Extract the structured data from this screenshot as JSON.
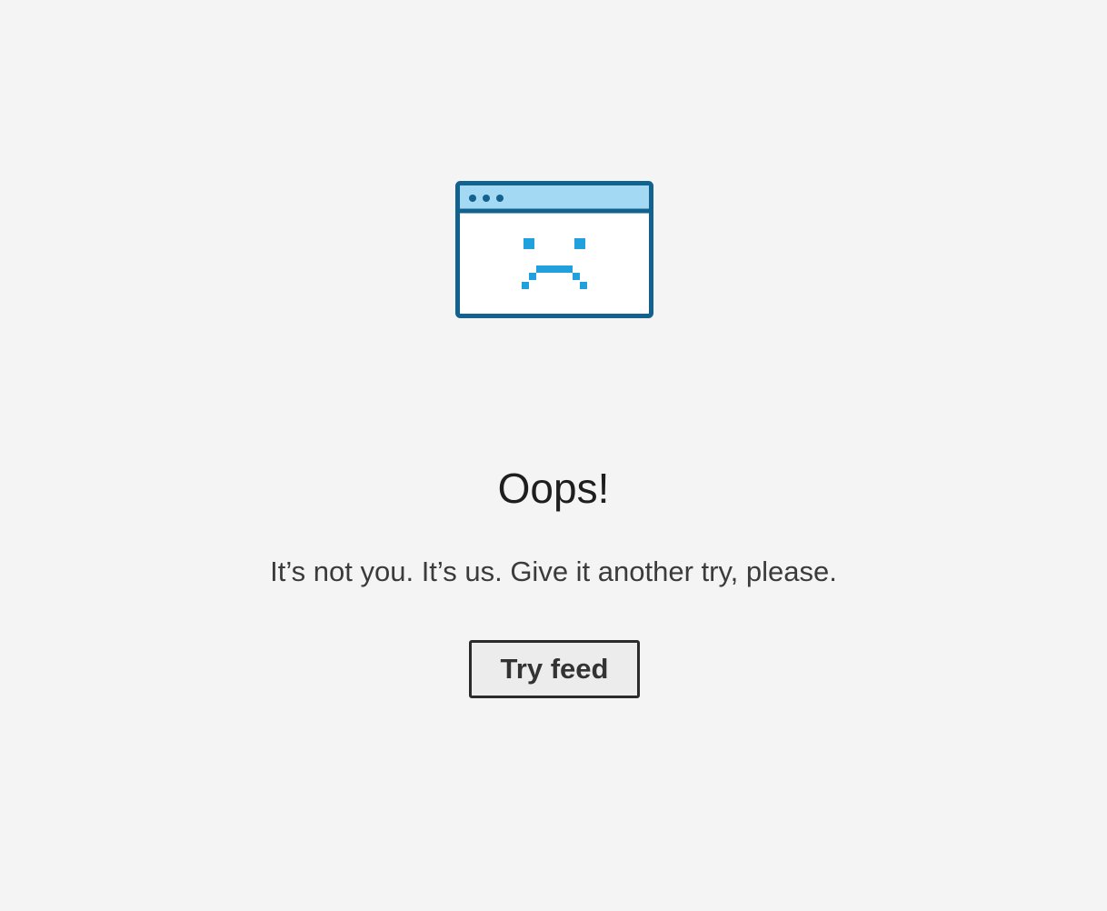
{
  "error": {
    "title": "Oops!",
    "message": "It’s not you. It’s us. Give it another try, please.",
    "button_label": "Try feed"
  },
  "illustration": {
    "icon": "sad-browser-window-icon",
    "colors": {
      "frame": "#12628f",
      "titlebar": "#a3d9f3",
      "window_body": "#ffffff",
      "face": "#20a0dc"
    }
  },
  "colors": {
    "background": "#f4f4f4",
    "title_text": "#1e1e1e",
    "body_text": "#3b3b3b",
    "button_border": "#2b2b2b",
    "button_background": "#ececec"
  }
}
